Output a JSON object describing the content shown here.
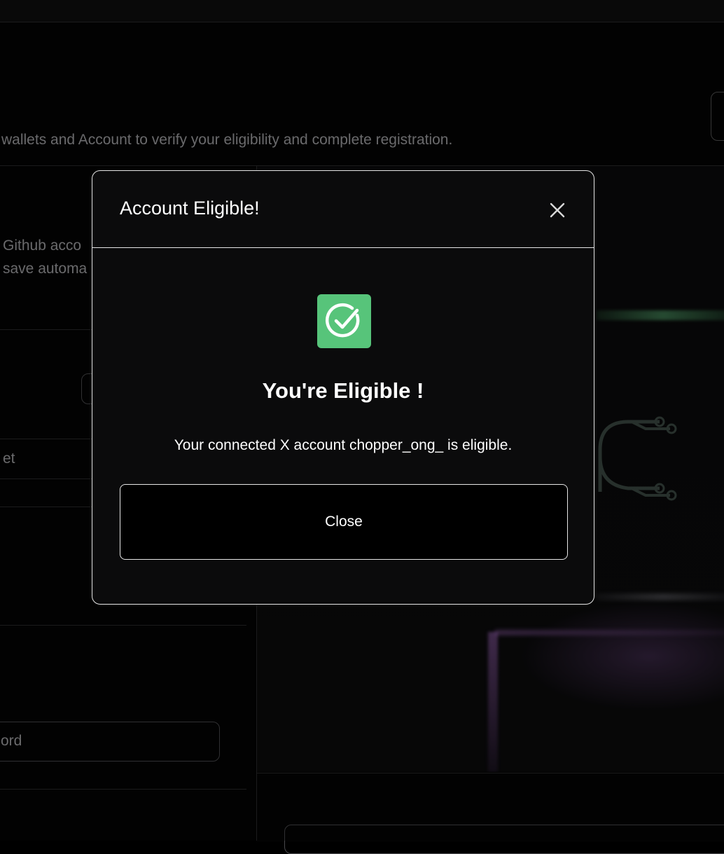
{
  "background": {
    "header_description": "wallets and Account to verify your eligibility and complete registration.",
    "left_text_1": "Github acco",
    "left_text_2": "save automa",
    "left_field_fragment": "et",
    "left_input_fragment": "ord"
  },
  "modal": {
    "title": "Account Eligible!",
    "close_icon": "close-icon",
    "status_icon": "check-circle-icon",
    "status_color": "#57c47a",
    "heading": "You're Eligible !",
    "message": "Your connected X account chopper_ong_ is eligible.",
    "close_button_label": "Close"
  }
}
